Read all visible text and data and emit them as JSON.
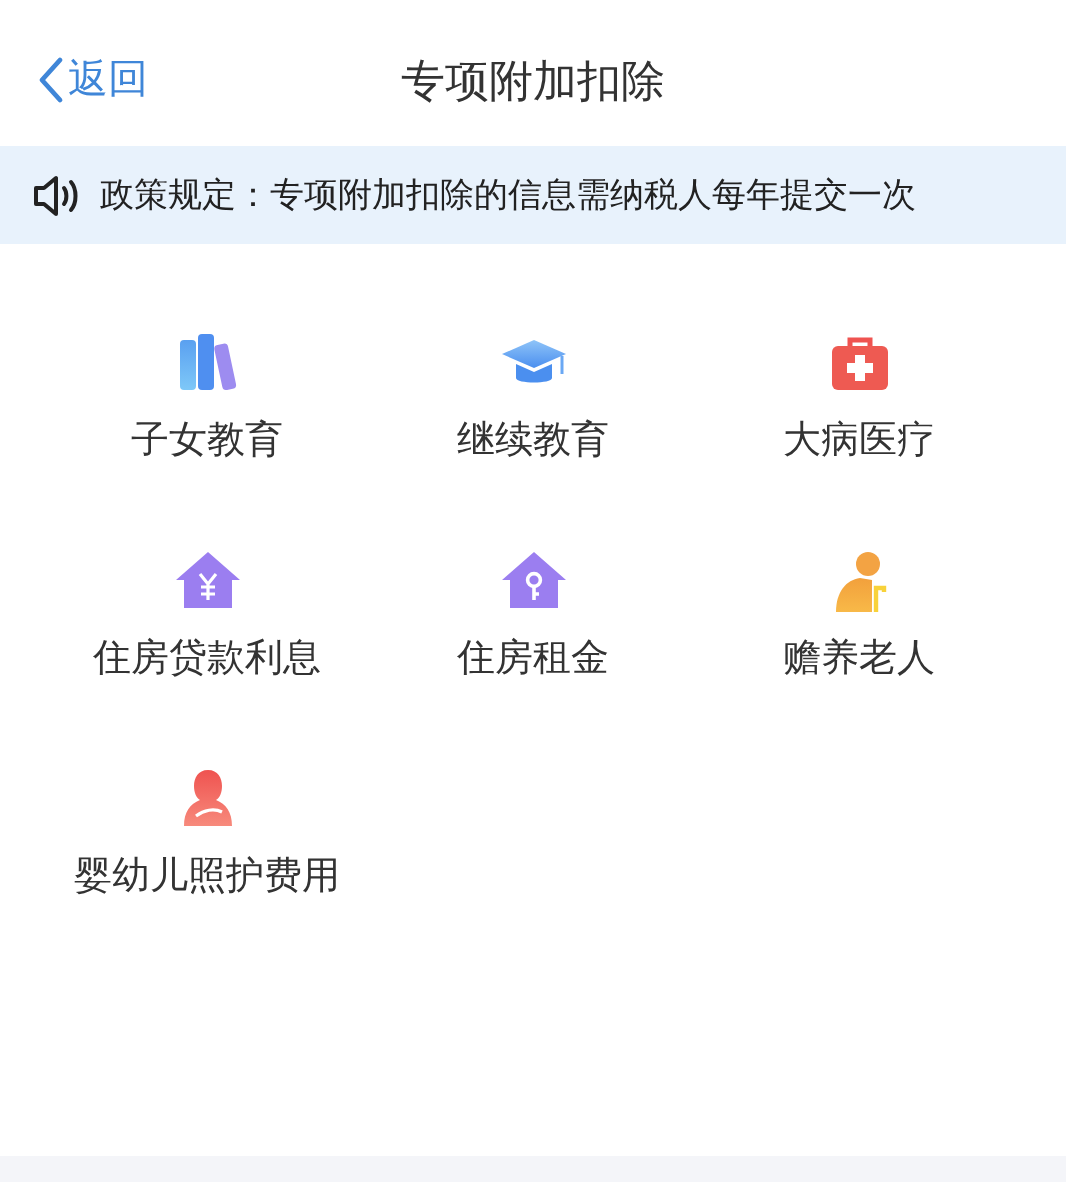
{
  "nav": {
    "back": "返回",
    "title": "专项附加扣除"
  },
  "notice": {
    "text": "政策规定：专项附加扣除的信息需纳税人每年提交一次"
  },
  "items": [
    {
      "kind": "books",
      "label": "子女教育"
    },
    {
      "kind": "cap",
      "label": "继续教育"
    },
    {
      "kind": "medkit",
      "label": "大病医疗"
    },
    {
      "kind": "house-yen",
      "label": "住房贷款利息"
    },
    {
      "kind": "house-key",
      "label": "住房租金"
    },
    {
      "kind": "elder",
      "label": "赡养老人"
    },
    {
      "kind": "mother",
      "label": "婴幼儿照护费用"
    }
  ]
}
